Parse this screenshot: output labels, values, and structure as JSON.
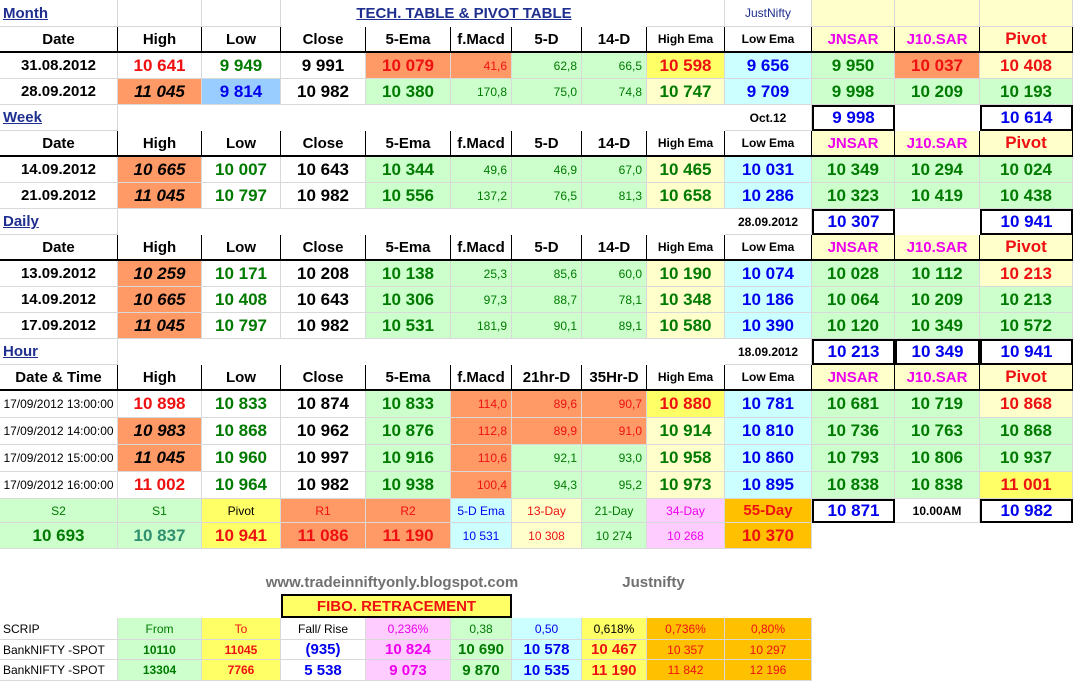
{
  "title": "TECH. TABLE  & PIVOT TABLE",
  "brand_top": "JustNifty",
  "headers": {
    "date": "Date",
    "high": "High",
    "low": "Low",
    "close": "Close",
    "ema5": "5-Ema",
    "fmacd": "f.Macd",
    "d5": "5-D",
    "d14": "14-D",
    "hema": "High Ema",
    "lema": "Low Ema",
    "jnsar": "JNSAR",
    "j10sar": "J10.SAR",
    "pivot": "Pivot",
    "date_time": "Date & Time",
    "hr21": "21hr-D",
    "hr35": "35Hr-D"
  },
  "sections": {
    "month": {
      "label": "Month",
      "rows": [
        [
          "31.08.2012",
          "10 641",
          "9 949",
          "9 991",
          "10 079",
          "41,6",
          "62,8",
          "66,5",
          "10 598",
          "9 656",
          "9 950",
          "10 037",
          "10 408"
        ],
        [
          "28.09.2012",
          "11 045",
          "9 814",
          "10 982",
          "10 380",
          "170,8",
          "75,0",
          "74,8",
          "10 747",
          "9 709",
          "9 998",
          "10 209",
          "10 193"
        ]
      ],
      "summary": {
        "label": "Oct.12",
        "jnsar": "9 998",
        "pivot": "10 614"
      }
    },
    "week": {
      "label": "Week",
      "rows": [
        [
          "14.09.2012",
          "10 665",
          "10 007",
          "10 643",
          "10 344",
          "49,6",
          "46,9",
          "67,0",
          "10 465",
          "10 031",
          "10 349",
          "10 294",
          "10 024"
        ],
        [
          "21.09.2012",
          "11 045",
          "10 797",
          "10 982",
          "10 556",
          "137,2",
          "76,5",
          "81,3",
          "10 658",
          "10 286",
          "10 323",
          "10 419",
          "10 438"
        ]
      ],
      "summary": {
        "label": "28.09.2012",
        "jnsar": "10 307",
        "pivot": "10 941"
      }
    },
    "daily": {
      "label": "Daily",
      "rows": [
        [
          "13.09.2012",
          "10 259",
          "10 171",
          "10 208",
          "10 138",
          "25,3",
          "85,6",
          "60,0",
          "10 190",
          "10 074",
          "10 028",
          "10 112",
          "10 213"
        ],
        [
          "14.09.2012",
          "10 665",
          "10 408",
          "10 643",
          "10 306",
          "97,3",
          "88,7",
          "78,1",
          "10 348",
          "10 186",
          "10 064",
          "10 209",
          "10 213"
        ],
        [
          "17.09.2012",
          "11 045",
          "10 797",
          "10 982",
          "10 531",
          "181,9",
          "90,1",
          "89,1",
          "10 580",
          "10 390",
          "10 120",
          "10 349",
          "10 572"
        ]
      ],
      "summary": {
        "label": "18.09.2012",
        "jnsar": "10 213",
        "j10sar": "10 349",
        "pivot": "10 941"
      }
    },
    "hour": {
      "label": "Hour",
      "rows": [
        [
          "17/09/2012 13:00:00",
          "10 898",
          "10 833",
          "10 874",
          "10 833",
          "114,0",
          "89,6",
          "90,7",
          "10 880",
          "10 781",
          "10 681",
          "10 719",
          "10 868"
        ],
        [
          "17/09/2012 14:00:00",
          "10 983",
          "10 868",
          "10 962",
          "10 876",
          "112,8",
          "89,9",
          "91,0",
          "10 914",
          "10 810",
          "10 736",
          "10 763",
          "10 868"
        ],
        [
          "17/09/2012 15:00:00",
          "11 045",
          "10 960",
          "10 997",
          "10 916",
          "110,6",
          "92,1",
          "93,0",
          "10 958",
          "10 860",
          "10 793",
          "10 806",
          "10 937"
        ],
        [
          "17/09/2012 16:00:00",
          "11 002",
          "10 964",
          "10 982",
          "10 938",
          "100,4",
          "94,3",
          "95,2",
          "10 973",
          "10 895",
          "10 838",
          "10 838",
          "11 001"
        ]
      ]
    }
  },
  "levels": {
    "labels": [
      "S2",
      "S1",
      "Pivot",
      "R1",
      "R2",
      "5-D Ema",
      "13-Day",
      "21-Day",
      "34-Day",
      "55-Day"
    ],
    "values": [
      "10 693",
      "10 837",
      "10 941",
      "11 086",
      "11 190",
      "10 531",
      "10 308",
      "10 274",
      "10 268",
      "10 370"
    ],
    "extra": {
      "value": "10 871",
      "time": "10.00AM",
      "pivot": "10 982"
    }
  },
  "footer": {
    "url": "www.tradeinniftyonly.blogspot.com",
    "brand": "Justnifty"
  },
  "fibo": {
    "title": "FIBO. RETRACEMENT",
    "headers": [
      "SCRIP",
      "From",
      "To",
      "Fall/ Rise",
      "0,236%",
      "0,38",
      "0,50",
      "0,618%",
      "0,736%",
      "0,80%"
    ],
    "rows": [
      [
        "BankNIFTY -SPOT",
        "10110",
        "11045",
        "(935)",
        "10 824",
        "10 690",
        "10 578",
        "10 467",
        "10 357",
        "10 297"
      ],
      [
        "BankNIFTY -SPOT",
        "13304",
        "7766",
        "5 538",
        "9 073",
        "9 870",
        "10 535",
        "11 190",
        "11 842",
        "12 196"
      ]
    ]
  },
  "colors": {
    "green_bg": "#ccffcc",
    "orange_bg": "#ff9966",
    "yellow_bg": "#ffff66",
    "blue_bg": "#99ccff",
    "red_text": "#ee1111",
    "green_text": "#007a00",
    "blue_text": "#0000ee",
    "magenta_text": "#ee00ee"
  }
}
